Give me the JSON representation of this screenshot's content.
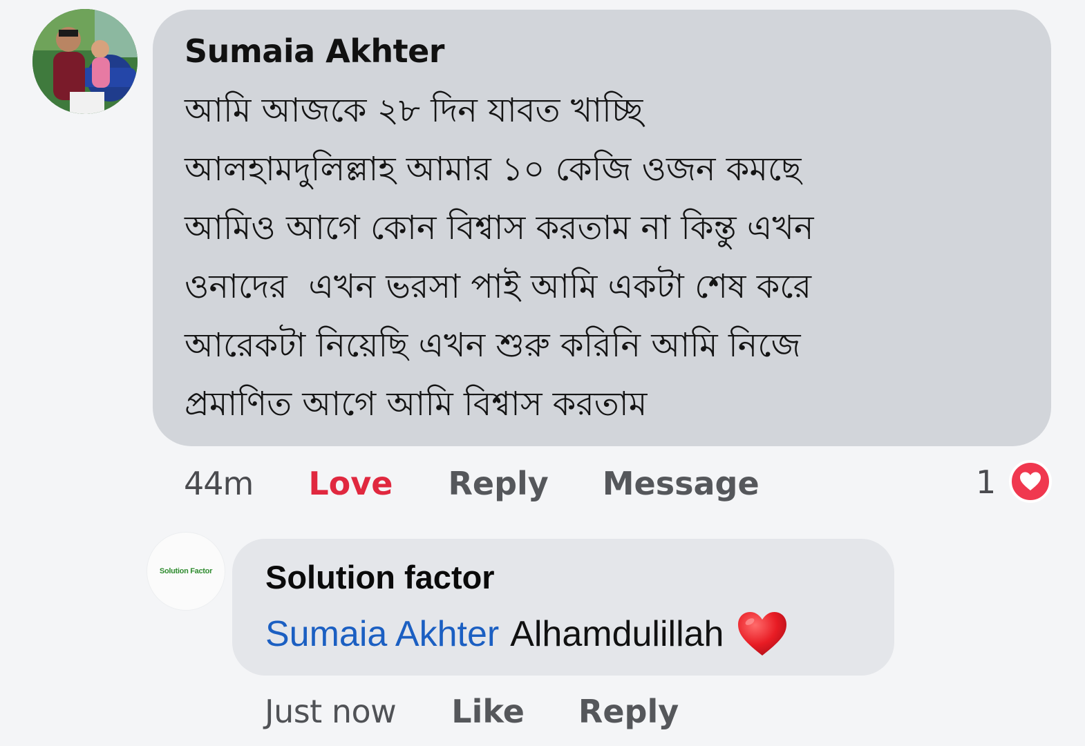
{
  "main_comment": {
    "author": "Sumaia Akhter",
    "text": "আমি আজকে ২৮ দিন যাবত খাচ্ছি\nআলহামদুলিল্লাহ আমার ১০ কেজি ওজন কমছে\nআমিও আগে কোন বিশ্বাস করতাম না কিন্তু এখন\nওনাদের  এখন ভরসা পাই আমি একটা শেষ করে\nআরেকটা নিয়েছি এখন শুরু করিনি আমি নিজে\nপ্রমাণিত আগে আমি বিশ্বাস করতাম",
    "time": "44m",
    "love_label": "Love",
    "reply_label": "Reply",
    "message_label": "Message",
    "reaction_count": "1",
    "reaction_icon": "heart-reaction-icon",
    "love_color": "#e0283f"
  },
  "reply_comment": {
    "author": "Solution factor",
    "avatar_text": "Solution Factor",
    "mention": "Sumaia Akhter",
    "text": "Alhamdulillah",
    "emoji": "red-heart-icon",
    "time": "Just now",
    "like_label": "Like",
    "reply_label": "Reply",
    "mention_color": "#1b5fc2"
  }
}
